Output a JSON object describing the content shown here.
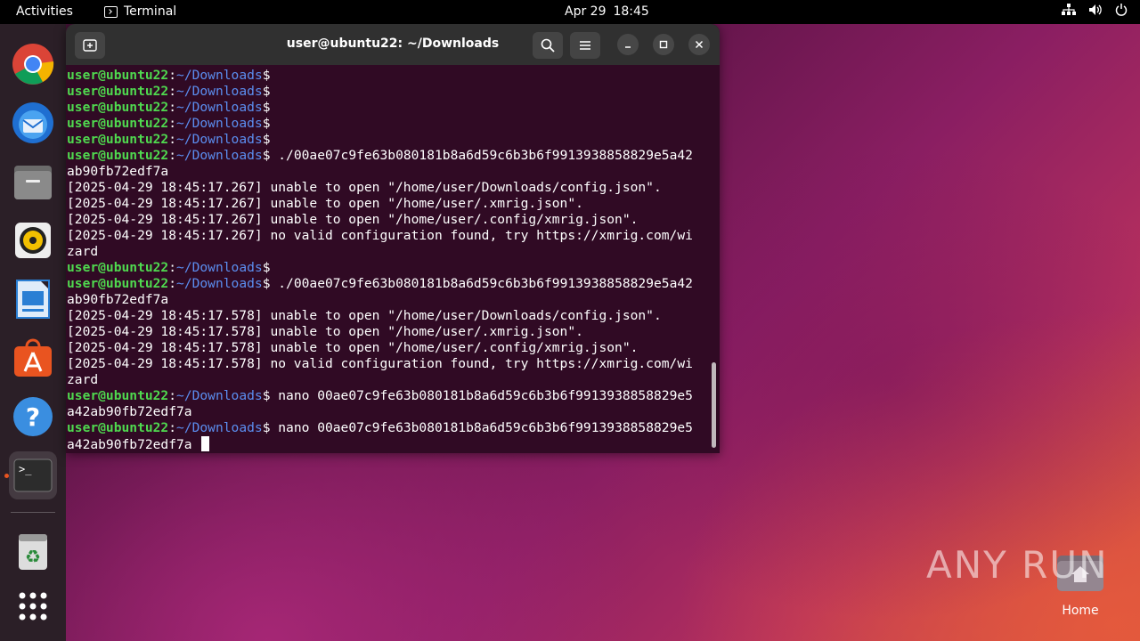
{
  "topbar": {
    "activities": "Activities",
    "app_name": "Terminal",
    "date": "Apr 29",
    "time": "18:45"
  },
  "window": {
    "title": "user@ubuntu22: ~/Downloads"
  },
  "terminal": {
    "user": "user@ubuntu22",
    "path": "~/Downloads",
    "lines": [
      {
        "prompt": true,
        "cmd": ""
      },
      {
        "prompt": true,
        "cmd": ""
      },
      {
        "prompt": true,
        "cmd": ""
      },
      {
        "prompt": true,
        "cmd": ""
      },
      {
        "prompt": true,
        "cmd": ""
      },
      {
        "prompt": true,
        "cmd": " ./00ae07c9fe63b080181b8a6d59c6b3b6f9913938858829e5a42"
      },
      {
        "prompt": false,
        "text": "ab90fb72edf7a"
      },
      {
        "prompt": false,
        "text": "[2025-04-29 18:45:17.267] unable to open \"/home/user/Downloads/config.json\"."
      },
      {
        "prompt": false,
        "text": "[2025-04-29 18:45:17.267] unable to open \"/home/user/.xmrig.json\"."
      },
      {
        "prompt": false,
        "text": "[2025-04-29 18:45:17.267] unable to open \"/home/user/.config/xmrig.json\"."
      },
      {
        "prompt": false,
        "text": "[2025-04-29 18:45:17.267] no valid configuration found, try https://xmrig.com/wi"
      },
      {
        "prompt": false,
        "text": "zard"
      },
      {
        "prompt": true,
        "cmd": ""
      },
      {
        "prompt": true,
        "cmd": " ./00ae07c9fe63b080181b8a6d59c6b3b6f9913938858829e5a42"
      },
      {
        "prompt": false,
        "text": "ab90fb72edf7a"
      },
      {
        "prompt": false,
        "text": "[2025-04-29 18:45:17.578] unable to open \"/home/user/Downloads/config.json\"."
      },
      {
        "prompt": false,
        "text": "[2025-04-29 18:45:17.578] unable to open \"/home/user/.xmrig.json\"."
      },
      {
        "prompt": false,
        "text": "[2025-04-29 18:45:17.578] unable to open \"/home/user/.config/xmrig.json\"."
      },
      {
        "prompt": false,
        "text": "[2025-04-29 18:45:17.578] no valid configuration found, try https://xmrig.com/wi"
      },
      {
        "prompt": false,
        "text": "zard"
      },
      {
        "prompt": true,
        "cmd": " nano 00ae07c9fe63b080181b8a6d59c6b3b6f9913938858829e5"
      },
      {
        "prompt": false,
        "text": "a42ab90fb72edf7a"
      },
      {
        "prompt": true,
        "cmd": " nano 00ae07c9fe63b080181b8a6d59c6b3b6f9913938858829e5"
      },
      {
        "prompt": false,
        "text": "a42ab90fb72edf7a ",
        "cursor": true
      }
    ]
  },
  "desktop": {
    "home_label": "Home",
    "watermark": "ANY RUN"
  },
  "dock": {
    "items": [
      "chrome-icon",
      "thunderbird-icon",
      "files-icon",
      "rhythmbox-icon",
      "writer-icon",
      "app-center-icon",
      "help-icon",
      "terminal-icon",
      "trash-icon",
      "app-grid-icon"
    ]
  },
  "colors": {
    "terminal_bg": "#300a24",
    "prompt_user": "#4fd94f",
    "prompt_path": "#5b8ef0",
    "accent": "#e95420"
  }
}
